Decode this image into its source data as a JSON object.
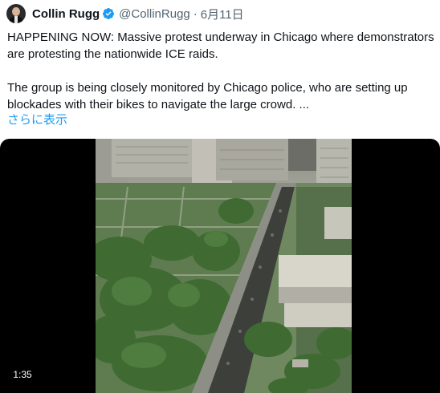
{
  "author": {
    "name": "Collin Rugg",
    "handle": "@CollinRugg",
    "separator": "·",
    "date": "6月11日"
  },
  "tweet": {
    "paragraph1": "HAPPENING NOW: Massive protest underway in Chicago where demonstrators are protesting the nationwide ICE raids.",
    "paragraph2": "The group is being closely monitored by Chicago police, who are setting up blockades with their bikes to navigate the large crowd. ...",
    "show_more": "さらに表示"
  },
  "video": {
    "duration": "1:35"
  },
  "colors": {
    "accent": "#1d9bf0",
    "secondary_text": "#536471",
    "primary_text": "#0f1419"
  },
  "icons": [
    "avatar",
    "verified-badge-icon"
  ]
}
